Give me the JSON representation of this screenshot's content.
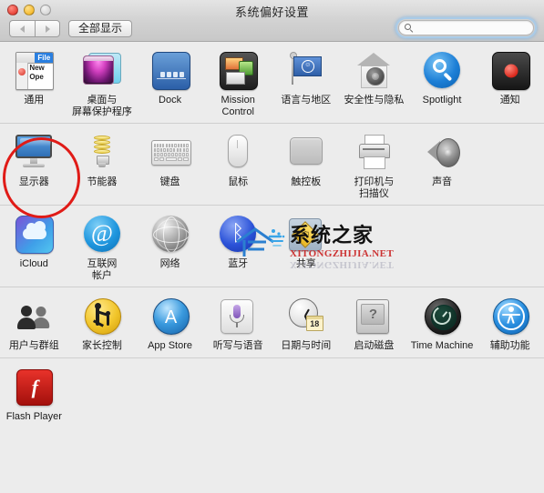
{
  "window": {
    "title": "系统偏好设置",
    "traffic_lights": [
      {
        "name": "close",
        "color": "#e8443a"
      },
      {
        "name": "minimize",
        "color": "#f6bc31"
      },
      {
        "name": "zoom",
        "color": "#d8d8d8"
      }
    ]
  },
  "toolbar": {
    "back_label": "",
    "forward_label": "",
    "show_all_label": "全部显示",
    "search": {
      "value": "",
      "placeholder": ""
    }
  },
  "annotation": {
    "type": "red-circle",
    "target": "显示器",
    "color": "#e01b17"
  },
  "watermark": {
    "title": "系统之家",
    "subtitle": "XITONGZHIJIA.NET"
  },
  "rows": [
    {
      "name": "personal",
      "items": [
        {
          "label": "通用",
          "icon": "general-icon",
          "icon_text": {
            "tab": "File",
            "line1": "New",
            "line2": "Ope"
          }
        },
        {
          "label": "桌面与\n屏幕保护程序",
          "icon": "desktop-screensaver-icon"
        },
        {
          "label": "Dock",
          "icon": "dock-icon"
        },
        {
          "label": "Mission\nControl",
          "icon": "mission-control-icon"
        },
        {
          "label": "语言与地区",
          "icon": "language-region-icon"
        },
        {
          "label": "安全性与隐私",
          "icon": "security-privacy-icon"
        },
        {
          "label": "Spotlight",
          "icon": "spotlight-icon"
        },
        {
          "label": "通知",
          "icon": "notifications-icon"
        }
      ]
    },
    {
      "name": "hardware",
      "items": [
        {
          "label": "显示器",
          "icon": "displays-icon"
        },
        {
          "label": "节能器",
          "icon": "energy-saver-icon"
        },
        {
          "label": "键盘",
          "icon": "keyboard-icon"
        },
        {
          "label": "鼠标",
          "icon": "mouse-icon"
        },
        {
          "label": "触控板",
          "icon": "trackpad-icon"
        },
        {
          "label": "打印机与\n扫描仪",
          "icon": "printers-scanners-icon"
        },
        {
          "label": "声音",
          "icon": "sound-icon"
        }
      ]
    },
    {
      "name": "internet-wireless",
      "items": [
        {
          "label": "iCloud",
          "icon": "icloud-icon"
        },
        {
          "label": "互联网\n帐户",
          "icon": "internet-accounts-icon"
        },
        {
          "label": "网络",
          "icon": "network-icon"
        },
        {
          "label": "蓝牙",
          "icon": "bluetooth-icon"
        },
        {
          "label": "共享",
          "icon": "sharing-icon"
        }
      ]
    },
    {
      "name": "system",
      "items": [
        {
          "label": "用户与群组",
          "icon": "users-groups-icon"
        },
        {
          "label": "家长控制",
          "icon": "parental-controls-icon"
        },
        {
          "label": "App Store",
          "icon": "app-store-icon"
        },
        {
          "label": "听写与语音",
          "icon": "dictation-speech-icon"
        },
        {
          "label": "日期与时间",
          "icon": "date-time-icon",
          "badge": "18"
        },
        {
          "label": "启动磁盘",
          "icon": "startup-disk-icon"
        },
        {
          "label": "Time Machine",
          "icon": "time-machine-icon"
        },
        {
          "label": "辅助功能",
          "icon": "accessibility-icon"
        }
      ]
    },
    {
      "name": "other",
      "items": [
        {
          "label": "Flash Player",
          "icon": "flash-player-icon"
        }
      ]
    }
  ]
}
